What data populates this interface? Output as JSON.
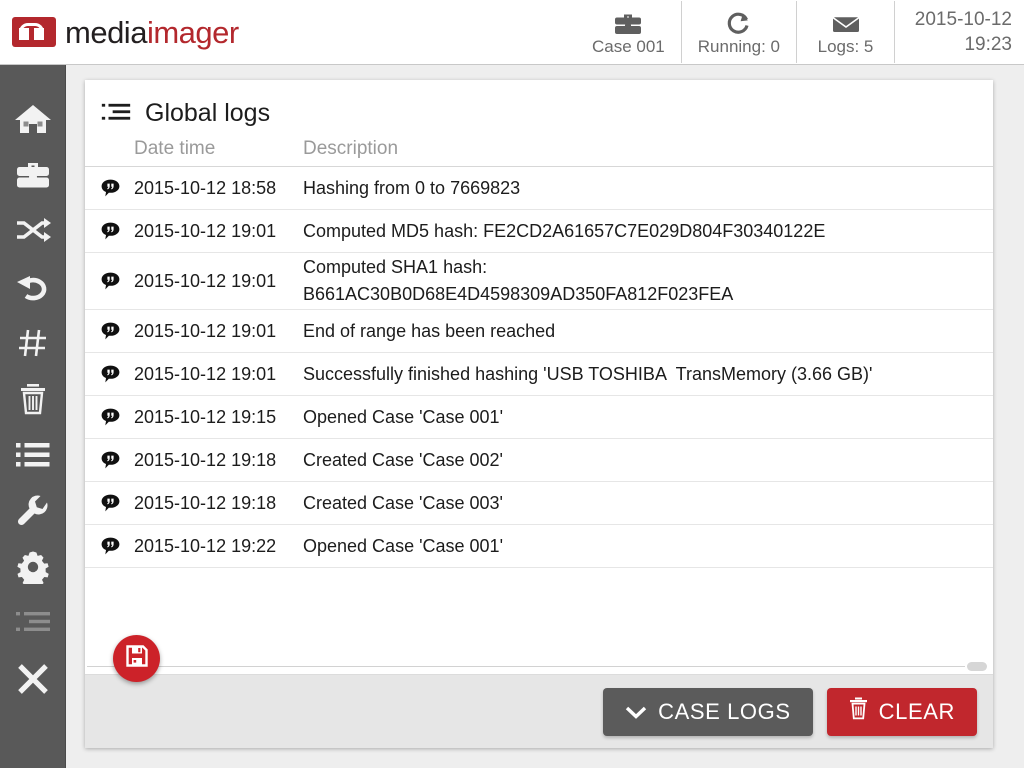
{
  "app": {
    "logo_text_dark": "media",
    "logo_text_red": "imager",
    "logo_icon": "mediaimager-logo-icon"
  },
  "topbar": {
    "status": [
      {
        "icon": "briefcase-icon",
        "label": "Case 001"
      },
      {
        "icon": "refresh-loop-icon",
        "label": "Running: 0"
      },
      {
        "icon": "envelope-icon",
        "label": "Logs: 5"
      }
    ],
    "date": "2015-10-12",
    "time": "19:23"
  },
  "sidebar": {
    "items": [
      {
        "icon": "home-icon",
        "name": "sidebar-item-home",
        "dim": false
      },
      {
        "icon": "briefcase-icon",
        "name": "sidebar-item-cases",
        "dim": false
      },
      {
        "icon": "shuffle-icon",
        "name": "sidebar-item-transfer",
        "dim": false
      },
      {
        "icon": "undo-icon",
        "name": "sidebar-item-restore",
        "dim": false
      },
      {
        "icon": "hash-icon",
        "name": "sidebar-item-hash",
        "dim": false
      },
      {
        "icon": "trash-icon",
        "name": "sidebar-item-wipe",
        "dim": false
      },
      {
        "icon": "list-icon",
        "name": "sidebar-item-list",
        "dim": false
      },
      {
        "icon": "wrench-icon",
        "name": "sidebar-item-tools",
        "dim": false
      },
      {
        "icon": "gear-icon",
        "name": "sidebar-item-settings",
        "dim": false
      },
      {
        "icon": "logs-list-icon",
        "name": "sidebar-item-logs",
        "dim": true
      },
      {
        "icon": "close-x-icon",
        "name": "sidebar-item-exit",
        "dim": false
      }
    ]
  },
  "panel": {
    "icon": "logs-list-icon",
    "title": "Global logs",
    "columns": {
      "date": "Date time",
      "description": "Description"
    },
    "rows": [
      {
        "icon": "comment-icon",
        "date": "2015-10-12 18:58",
        "desc": "Hashing from 0 to 7669823"
      },
      {
        "icon": "comment-icon",
        "date": "2015-10-12 19:01",
        "desc": "Computed MD5 hash: FE2CD2A61657C7E029D804F30340122E"
      },
      {
        "icon": "comment-icon",
        "date": "2015-10-12 19:01",
        "desc": "Computed SHA1 hash:\nB661AC30B0D68E4D4598309AD350FA812F023FEA"
      },
      {
        "icon": "comment-icon",
        "date": "2015-10-12 19:01",
        "desc": "End of range has been reached"
      },
      {
        "icon": "comment-icon",
        "date": "2015-10-12 19:01",
        "desc": "Successfully finished hashing 'USB TOSHIBA  TransMemory (3.66 GB)'"
      },
      {
        "icon": "comment-icon",
        "date": "2015-10-12 19:15",
        "desc": "Opened Case 'Case 001'"
      },
      {
        "icon": "comment-icon",
        "date": "2015-10-12 19:18",
        "desc": "Created Case 'Case 002'"
      },
      {
        "icon": "comment-icon",
        "date": "2015-10-12 19:18",
        "desc": "Created Case 'Case 003'"
      },
      {
        "icon": "comment-icon",
        "date": "2015-10-12 19:22",
        "desc": "Opened Case 'Case 001'"
      }
    ]
  },
  "footer": {
    "case_logs_label": "CASE LOGS",
    "case_logs_icon": "chevron-down-icon",
    "clear_label": "CLEAR",
    "clear_icon": "trash-icon"
  },
  "fab": {
    "icon": "save-floppy-icon"
  },
  "colors": {
    "brand_red": "#b3282d",
    "button_red": "#c1272d",
    "fab_red": "#cc2229",
    "sidebar_gray": "#595959",
    "footer_gray": "#e6e6e6",
    "content_gray": "#eeeeee"
  }
}
